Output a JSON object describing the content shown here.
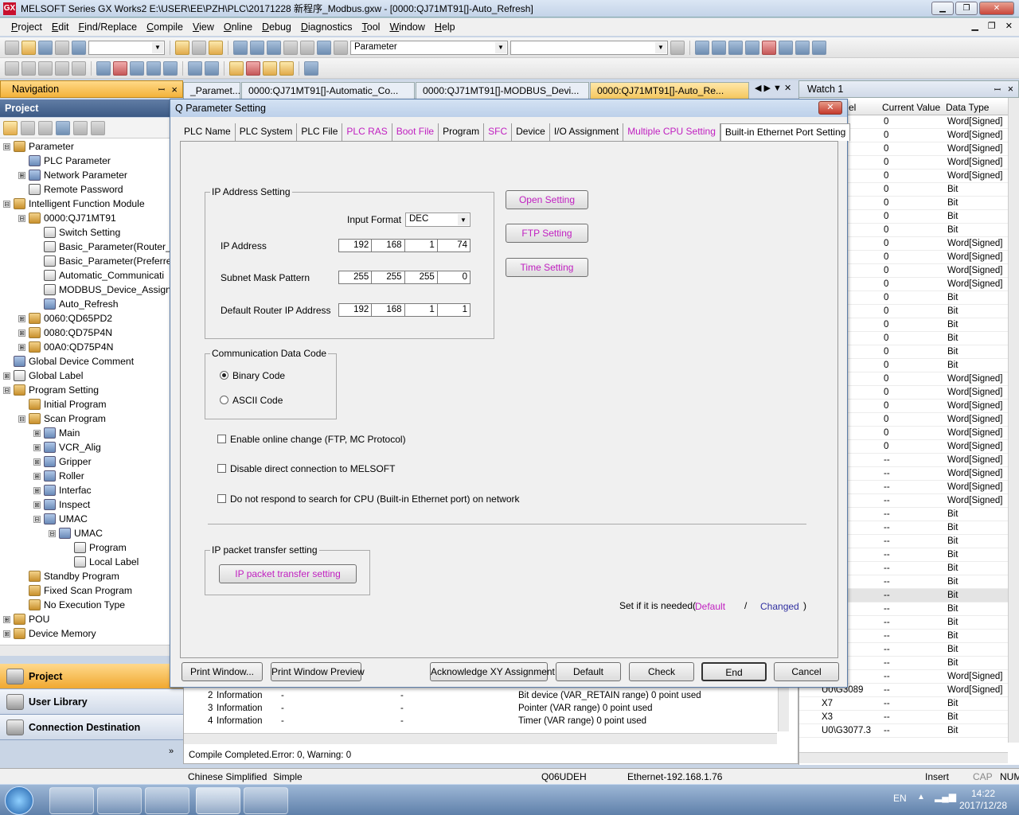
{
  "app": {
    "title": "MELSOFT Series GX Works2 E:\\USER\\EE\\PZH\\PLC\\20171228 新程序_Modbus.gxw - [0000:QJ71MT91[]-Auto_Refresh]",
    "icon_text": "GX",
    "win_min": "▁",
    "win_max": "❐",
    "win_close": "✕"
  },
  "menu": [
    "Project",
    "Edit",
    "Find/Replace",
    "Compile",
    "View",
    "Online",
    "Debug",
    "Diagnostics",
    "Tool",
    "Window",
    "Help"
  ],
  "toolbar": {
    "combo_main": "Parameter"
  },
  "navigation": {
    "header": "Navigation",
    "pin": "ꟷ",
    "close": "×",
    "project_header": "Project"
  },
  "tree": [
    {
      "label": "Parameter",
      "depth": 0,
      "ex": "⊟",
      "icon": "folder-icon"
    },
    {
      "label": "PLC Parameter",
      "depth": 1,
      "ex": "",
      "icon": "parameter-icon"
    },
    {
      "label": "Network Parameter",
      "depth": 1,
      "ex": "⊞",
      "icon": "network-icon"
    },
    {
      "label": "Remote Password",
      "depth": 1,
      "ex": "",
      "icon": "password-icon"
    },
    {
      "label": "Intelligent Function Module",
      "depth": 0,
      "ex": "⊟",
      "icon": "folder-icon"
    },
    {
      "label": "0000:QJ71MT91",
      "depth": 1,
      "ex": "⊟",
      "icon": "module-icon"
    },
    {
      "label": "Switch Setting",
      "depth": 2,
      "ex": "",
      "icon": "switch-icon"
    },
    {
      "label": "Basic_Parameter(Router_I",
      "depth": 2,
      "ex": "",
      "icon": "document-icon"
    },
    {
      "label": "Basic_Parameter(Preferre",
      "depth": 2,
      "ex": "",
      "icon": "document-icon"
    },
    {
      "label": "Automatic_Communicati",
      "depth": 2,
      "ex": "",
      "icon": "document-icon"
    },
    {
      "label": "MODBUS_Device_Assignr",
      "depth": 2,
      "ex": "",
      "icon": "document-icon"
    },
    {
      "label": "Auto_Refresh",
      "depth": 2,
      "ex": "",
      "icon": "refresh-icon"
    },
    {
      "label": "0060:QD65PD2",
      "depth": 1,
      "ex": "⊞",
      "icon": "module-icon"
    },
    {
      "label": "0080:QD75P4N",
      "depth": 1,
      "ex": "⊞",
      "icon": "module-icon"
    },
    {
      "label": "00A0:QD75P4N",
      "depth": 1,
      "ex": "⊞",
      "icon": "module-icon"
    },
    {
      "label": "Global Device Comment",
      "depth": 0,
      "ex": "",
      "icon": "comment-icon"
    },
    {
      "label": "Global Label",
      "depth": 0,
      "ex": "⊞",
      "icon": "label-icon"
    },
    {
      "label": "Program Setting",
      "depth": 0,
      "ex": "⊟",
      "icon": "folder-icon"
    },
    {
      "label": "Initial Program",
      "depth": 1,
      "ex": "",
      "icon": "program-icon"
    },
    {
      "label": "Scan Program",
      "depth": 1,
      "ex": "⊟",
      "icon": "program-icon"
    },
    {
      "label": "Main",
      "depth": 2,
      "ex": "⊞",
      "icon": "pou-icon"
    },
    {
      "label": "VCR_Alig",
      "depth": 2,
      "ex": "⊞",
      "icon": "pou-icon"
    },
    {
      "label": "Gripper",
      "depth": 2,
      "ex": "⊞",
      "icon": "pou-icon"
    },
    {
      "label": "Roller",
      "depth": 2,
      "ex": "⊞",
      "icon": "pou-icon"
    },
    {
      "label": "Interfac",
      "depth": 2,
      "ex": "⊞",
      "icon": "pou-icon"
    },
    {
      "label": "Inspect",
      "depth": 2,
      "ex": "⊞",
      "icon": "pou-icon"
    },
    {
      "label": "UMAC",
      "depth": 2,
      "ex": "⊟",
      "icon": "pou-icon"
    },
    {
      "label": "UMAC",
      "depth": 3,
      "ex": "⊟",
      "icon": "pou-icon"
    },
    {
      "label": "Program",
      "depth": 4,
      "ex": "",
      "icon": "ladder-icon"
    },
    {
      "label": "Local Label",
      "depth": 4,
      "ex": "",
      "icon": "label-icon"
    },
    {
      "label": "Standby Program",
      "depth": 1,
      "ex": "",
      "icon": "program-icon"
    },
    {
      "label": "Fixed Scan Program",
      "depth": 1,
      "ex": "",
      "icon": "program-icon"
    },
    {
      "label": "No Execution Type",
      "depth": 1,
      "ex": "",
      "icon": "program-icon"
    },
    {
      "label": "POU",
      "depth": 0,
      "ex": "⊞",
      "icon": "folder-icon"
    },
    {
      "label": "Device Memory",
      "depth": 0,
      "ex": "⊞",
      "icon": "folder-icon"
    }
  ],
  "nav_buttons": [
    {
      "label": "Project",
      "active": true
    },
    {
      "label": "User Library",
      "active": false
    },
    {
      "label": "Connection Destination",
      "active": false
    }
  ],
  "doc_tabs": [
    "_Paramet...",
    "0000:QJ71MT91[]-Automatic_Co...",
    "0000:QJ71MT91[]-MODBUS_Devi...",
    "0000:QJ71MT91[]-Auto_Re..."
  ],
  "watch": {
    "title": "Watch 1",
    "col_label": "el",
    "col_value": "Current Value",
    "col_type": "Data Type",
    "rows": [
      {
        "dev": "",
        "val": "0",
        "type": "Word[Signed]"
      },
      {
        "dev": "",
        "val": "0",
        "type": "Word[Signed]"
      },
      {
        "dev": "",
        "val": "0",
        "type": "Word[Signed]"
      },
      {
        "dev": "",
        "val": "0",
        "type": "Word[Signed]"
      },
      {
        "dev": "",
        "val": "0",
        "type": "Word[Signed]"
      },
      {
        "dev": "",
        "val": "0",
        "type": "Bit"
      },
      {
        "dev": "",
        "val": "0",
        "type": "Bit"
      },
      {
        "dev": "",
        "val": "0",
        "type": "Bit"
      },
      {
        "dev": "",
        "val": "0",
        "type": "Bit"
      },
      {
        "dev": "",
        "val": "0",
        "type": "Word[Signed]"
      },
      {
        "dev": "",
        "val": "0",
        "type": "Word[Signed]"
      },
      {
        "dev": "",
        "val": "0",
        "type": "Word[Signed]"
      },
      {
        "dev": "",
        "val": "0",
        "type": "Word[Signed]"
      },
      {
        "dev": "",
        "val": "0",
        "type": "Bit"
      },
      {
        "dev": "",
        "val": "0",
        "type": "Bit"
      },
      {
        "dev": "",
        "val": "0",
        "type": "Bit"
      },
      {
        "dev": "",
        "val": "0",
        "type": "Bit"
      },
      {
        "dev": "",
        "val": "0",
        "type": "Bit"
      },
      {
        "dev": "",
        "val": "0",
        "type": "Bit"
      },
      {
        "dev": "",
        "val": "0",
        "type": "Word[Signed]"
      },
      {
        "dev": "",
        "val": "0",
        "type": "Word[Signed]"
      },
      {
        "dev": "",
        "val": "0",
        "type": "Word[Signed]"
      },
      {
        "dev": "",
        "val": "0",
        "type": "Word[Signed]"
      },
      {
        "dev": "",
        "val": "0",
        "type": "Word[Signed]"
      },
      {
        "dev": "",
        "val": "0",
        "type": "Word[Signed]"
      },
      {
        "dev": "",
        "val": "--",
        "type": "Word[Signed]"
      },
      {
        "dev": "",
        "val": "--",
        "type": "Word[Signed]"
      },
      {
        "dev": "",
        "val": "--",
        "type": "Word[Signed]"
      },
      {
        "dev": "",
        "val": "--",
        "type": "Word[Signed]"
      },
      {
        "dev": "",
        "val": "--",
        "type": "Bit"
      },
      {
        "dev": "",
        "val": "--",
        "type": "Bit"
      },
      {
        "dev": "",
        "val": "--",
        "type": "Bit"
      },
      {
        "dev": "",
        "val": "--",
        "type": "Bit"
      },
      {
        "dev": "",
        "val": "--",
        "type": "Bit"
      },
      {
        "dev": "",
        "val": "--",
        "type": "Bit"
      },
      {
        "dev": "",
        "val": "--",
        "type": "Bit"
      },
      {
        "dev": "",
        "val": "--",
        "type": "Bit"
      },
      {
        "dev": "",
        "val": "--",
        "type": "Bit"
      },
      {
        "dev": "",
        "val": "--",
        "type": "Bit"
      },
      {
        "dev": "",
        "val": "--",
        "type": "Bit"
      },
      {
        "dev": "",
        "val": "--",
        "type": "Bit"
      },
      {
        "dev": "3088",
        "val": "--",
        "type": "Word[Signed]"
      },
      {
        "dev": "U0\\G3089",
        "val": "--",
        "type": "Word[Signed]"
      },
      {
        "dev": "X7",
        "val": "--",
        "type": "Bit"
      },
      {
        "dev": "X3",
        "val": "--",
        "type": "Bit"
      },
      {
        "dev": "U0\\G3077.3",
        "val": "--",
        "type": "Bit"
      }
    ]
  },
  "output": {
    "rows": [
      {
        "no": "2",
        "kind": "Information",
        "a": "-",
        "b": "-",
        "msg": "Bit device (VAR_RETAIN range) 0 point used"
      },
      {
        "no": "3",
        "kind": "Information",
        "a": "-",
        "b": "-",
        "msg": "Pointer (VAR range) 0 point used"
      },
      {
        "no": "4",
        "kind": "Information",
        "a": "-",
        "b": "-",
        "msg": "Timer (VAR range) 0 point used"
      }
    ],
    "status": "Compile Completed.Error: 0, Warning: 0"
  },
  "statusbar": {
    "lang": "Chinese Simplified",
    "mode": "Simple",
    "cpu": "Q06UDEH",
    "conn": "Ethernet-192.168.1.76",
    "ins": "Insert",
    "cap": "CAP",
    "num": "NUM"
  },
  "taskbar": {
    "lang": "EN",
    "time": "14:22",
    "date": "2017/12/28"
  },
  "dialog": {
    "title": "Q Parameter Setting",
    "close": "✕",
    "tabs": [
      {
        "label": "PLC Name",
        "pink": false
      },
      {
        "label": "PLC System",
        "pink": false
      },
      {
        "label": "PLC File",
        "pink": false
      },
      {
        "label": "PLC RAS",
        "pink": true
      },
      {
        "label": "Boot File",
        "pink": true
      },
      {
        "label": "Program",
        "pink": false
      },
      {
        "label": "SFC",
        "pink": true
      },
      {
        "label": "Device",
        "pink": false
      },
      {
        "label": "I/O Assignment",
        "pink": false
      },
      {
        "label": "Multiple CPU Setting",
        "pink": true
      },
      {
        "label": "Built-in Ethernet Port Setting",
        "pink": false,
        "active": true
      }
    ],
    "ip_group": "IP Address Setting",
    "input_format_label": "Input Format",
    "input_format_value": "DEC",
    "ip_address_label": "IP Address",
    "ip_address": [
      "192",
      "168",
      "1",
      "74"
    ],
    "subnet_label": "Subnet Mask Pattern",
    "subnet": [
      "255",
      "255",
      "255",
      "0"
    ],
    "router_label": "Default Router IP Address",
    "router": [
      "192",
      "168",
      "1",
      "1"
    ],
    "open_setting": "Open Setting",
    "ftp_setting": "FTP Setting",
    "time_setting": "Time Setting",
    "comm_group": "Communication Data Code",
    "binary_code": "Binary Code",
    "ascii_code": "ASCII Code",
    "chk_online": "Enable online change (FTP, MC Protocol)",
    "chk_disable": "Disable direct connection to MELSOFT",
    "chk_search": "Do not respond to search for CPU (Built-in Ethernet port) on network",
    "packet_group": "IP packet transfer setting",
    "packet_button": "IP packet transfer setting",
    "legend_prefix": "Set if it is needed(",
    "legend_default": "Default",
    "legend_slash": "/",
    "legend_changed": "Changed",
    "legend_suffix": ")",
    "btn_print": "Print Window...",
    "btn_preview": "Print Window Preview",
    "btn_ack": "Acknowledge XY Assignment",
    "btn_default": "Default",
    "btn_check": "Check",
    "btn_end": "End",
    "btn_cancel": "Cancel"
  },
  "colors": {
    "pink": "#c020c0",
    "changed": "#3030a0",
    "nav_orange": "#f3b23a"
  }
}
